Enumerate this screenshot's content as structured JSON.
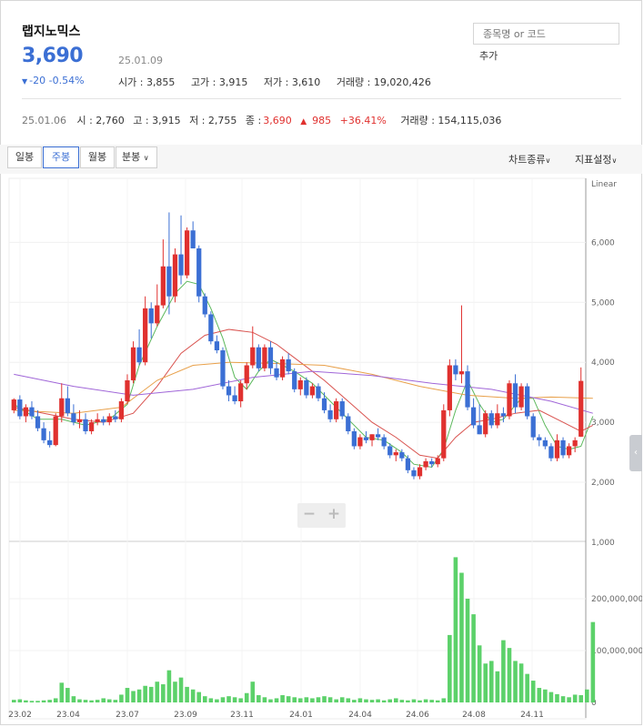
{
  "stock": {
    "name": "랩지노믹스",
    "price": "3,690",
    "date": "25.01.09",
    "change": "-20",
    "change_pct": "-0.54%",
    "open": "시가 : 3,855",
    "high": "고가 : 3,915",
    "low": "저가 : 3,610",
    "volume": "거래량 : 19,020,426"
  },
  "search": {
    "placeholder": "종목명 or 코드",
    "add_label": "추가"
  },
  "period_bar": {
    "date": "25.01.06",
    "open": "시 : 2,760",
    "high": "고 : 3,915",
    "low": "저 : 2,755",
    "close_label": "종 :",
    "close_value": "3,690",
    "diff": "985",
    "diff_pct": "+36.41%",
    "volume": "거래량 : 154,115,036"
  },
  "tabs": {
    "day": "일봉",
    "week": "주봉",
    "month": "월봉",
    "minute": "분봉"
  },
  "controls": {
    "chart_type": "차트종류",
    "indicator": "지표설정"
  },
  "colors": {
    "up": "#e0312f",
    "down": "#3b6fd4",
    "ma5": "#5cb85c",
    "ma20": "#d9534f",
    "ma60": "#e8a04a",
    "ma120": "#a066d8",
    "volume": "#5cd16a"
  },
  "chart_data": {
    "type": "candlestick",
    "scale_label": "Linear",
    "price_ticks": [
      "1,000",
      "2,000",
      "3,000",
      "4,000",
      "5,000",
      "6,000"
    ],
    "volume_ticks": [
      "0",
      "100,000,000",
      "200,000,000"
    ],
    "x_ticks": [
      "23.02",
      "23.04",
      "23.07",
      "23.09",
      "23.11",
      "24.01",
      "24.04",
      "24.06",
      "24.08",
      "24.11"
    ],
    "ohlc": [
      [
        3200,
        3400,
        3150,
        3380
      ],
      [
        3380,
        3450,
        3050,
        3100
      ],
      [
        3100,
        3300,
        3000,
        3250
      ],
      [
        3250,
        3350,
        3050,
        3100
      ],
      [
        3100,
        3200,
        2850,
        2900
      ],
      [
        2900,
        3000,
        2650,
        2700
      ],
      [
        2700,
        2850,
        2580,
        2620
      ],
      [
        2620,
        3150,
        2600,
        3100
      ],
      [
        3100,
        3650,
        3000,
        3400
      ],
      [
        3400,
        3600,
        3100,
        3150
      ],
      [
        3150,
        3300,
        2950,
        3000
      ],
      [
        3000,
        3200,
        2900,
        3050
      ],
      [
        3050,
        3150,
        2800,
        2850
      ],
      [
        2850,
        3050,
        2800,
        3000
      ],
      [
        3000,
        3150,
        2950,
        3050
      ],
      [
        3050,
        3100,
        2950,
        3000
      ],
      [
        3000,
        3150,
        2950,
        3100
      ],
      [
        3100,
        3200,
        3000,
        3050
      ],
      [
        3050,
        3400,
        3000,
        3350
      ],
      [
        3350,
        3800,
        3300,
        3700
      ],
      [
        3700,
        4350,
        3650,
        4250
      ],
      [
        4250,
        4550,
        3950,
        4000
      ],
      [
        4000,
        5100,
        3950,
        4900
      ],
      [
        4900,
        5000,
        4400,
        4650
      ],
      [
        4650,
        5300,
        4600,
        4950
      ],
      [
        4950,
        6050,
        4900,
        5600
      ],
      [
        5600,
        6500,
        4800,
        5100
      ],
      [
        5100,
        5900,
        5000,
        5800
      ],
      [
        5800,
        6450,
        5300,
        5450
      ],
      [
        5450,
        6250,
        5400,
        6200
      ],
      [
        6200,
        6350,
        5900,
        5900
      ],
      [
        5900,
        5950,
        5000,
        5100
      ],
      [
        5100,
        5150,
        4750,
        4800
      ],
      [
        4800,
        4850,
        4300,
        4350
      ],
      [
        4350,
        4450,
        4150,
        4200
      ],
      [
        4200,
        4250,
        3550,
        3600
      ],
      [
        3600,
        3700,
        3350,
        3450
      ],
      [
        3450,
        3600,
        3300,
        3350
      ],
      [
        3350,
        3700,
        3250,
        3650
      ],
      [
        3650,
        4000,
        3550,
        3950
      ],
      [
        3950,
        4600,
        3900,
        4250
      ],
      [
        4250,
        4300,
        3850,
        3900
      ],
      [
        3900,
        4300,
        3850,
        4250
      ],
      [
        4250,
        4350,
        3800,
        3900
      ],
      [
        3900,
        4000,
        3700,
        3750
      ],
      [
        3750,
        4100,
        3700,
        4050
      ],
      [
        4050,
        4150,
        3800,
        3850
      ],
      [
        3850,
        3900,
        3500,
        3550
      ],
      [
        3550,
        3750,
        3450,
        3700
      ],
      [
        3700,
        3750,
        3400,
        3450
      ],
      [
        3450,
        3650,
        3400,
        3600
      ],
      [
        3600,
        3650,
        3350,
        3400
      ],
      [
        3400,
        3500,
        3150,
        3200
      ],
      [
        3200,
        3300,
        3000,
        3050
      ],
      [
        3050,
        3400,
        3000,
        3350
      ],
      [
        3350,
        3400,
        3050,
        3100
      ],
      [
        3100,
        3150,
        2800,
        2850
      ],
      [
        2850,
        2900,
        2550,
        2600
      ],
      [
        2600,
        2800,
        2550,
        2750
      ],
      [
        2750,
        2850,
        2650,
        2700
      ],
      [
        2700,
        2800,
        2600,
        2800
      ],
      [
        2800,
        2900,
        2700,
        2750
      ],
      [
        2750,
        2800,
        2550,
        2600
      ],
      [
        2600,
        2650,
        2400,
        2450
      ],
      [
        2450,
        2550,
        2350,
        2500
      ],
      [
        2500,
        2550,
        2350,
        2400
      ],
      [
        2400,
        2450,
        2150,
        2200
      ],
      [
        2200,
        2250,
        2050,
        2100
      ],
      [
        2100,
        2300,
        2050,
        2250
      ],
      [
        2250,
        2400,
        2200,
        2350
      ],
      [
        2350,
        2400,
        2250,
        2300
      ],
      [
        2300,
        2450,
        2250,
        2400
      ],
      [
        2400,
        3300,
        2350,
        3200
      ],
      [
        3200,
        4050,
        3100,
        3950
      ],
      [
        3950,
        4050,
        3700,
        3800
      ],
      [
        3800,
        4950,
        3650,
        3850
      ],
      [
        3850,
        3950,
        3200,
        3250
      ],
      [
        3250,
        3400,
        2900,
        2950
      ],
      [
        2950,
        3300,
        2800,
        2800
      ],
      [
        2800,
        3200,
        2750,
        3150
      ],
      [
        3150,
        3200,
        2900,
        2950
      ],
      [
        2950,
        3300,
        2900,
        3150
      ],
      [
        3150,
        3250,
        3000,
        3100
      ],
      [
        3100,
        3700,
        3050,
        3650
      ],
      [
        3650,
        3800,
        3150,
        3250
      ],
      [
        3250,
        3650,
        3200,
        3600
      ],
      [
        3600,
        3650,
        3050,
        3100
      ],
      [
        3100,
        3150,
        2700,
        2750
      ],
      [
        2750,
        2800,
        2600,
        2700
      ],
      [
        2700,
        2750,
        2550,
        2600
      ],
      [
        2600,
        2650,
        2350,
        2400
      ],
      [
        2400,
        2800,
        2350,
        2700
      ],
      [
        2700,
        2750,
        2400,
        2450
      ],
      [
        2450,
        2650,
        2400,
        2600
      ],
      [
        2600,
        2750,
        2500,
        2700
      ],
      [
        2760,
        3915,
        2755,
        3690
      ]
    ],
    "ma": [
      {
        "key": "ma5",
        "points": [
          [
            0,
            3300
          ],
          [
            4,
            3050
          ],
          [
            8,
            3050
          ],
          [
            12,
            2950
          ],
          [
            16,
            3050
          ],
          [
            19,
            3300
          ],
          [
            21,
            3950
          ],
          [
            24,
            4600
          ],
          [
            27,
            5150
          ],
          [
            29,
            5350
          ],
          [
            31,
            5300
          ],
          [
            33,
            4900
          ],
          [
            35,
            4400
          ],
          [
            37,
            3750
          ],
          [
            39,
            3550
          ],
          [
            41,
            3850
          ],
          [
            43,
            4050
          ],
          [
            45,
            3950
          ],
          [
            47,
            3850
          ],
          [
            50,
            3650
          ],
          [
            53,
            3350
          ],
          [
            56,
            3050
          ],
          [
            59,
            2750
          ],
          [
            62,
            2700
          ],
          [
            65,
            2500
          ],
          [
            67,
            2300
          ],
          [
            70,
            2250
          ],
          [
            72,
            2550
          ],
          [
            74,
            3200
          ],
          [
            76,
            3700
          ],
          [
            78,
            3300
          ],
          [
            80,
            3000
          ],
          [
            82,
            3050
          ],
          [
            85,
            3400
          ],
          [
            87,
            3400
          ],
          [
            89,
            2950
          ],
          [
            91,
            2600
          ],
          [
            93,
            2550
          ],
          [
            95,
            2600
          ],
          [
            97,
            3100
          ]
        ]
      },
      {
        "key": "ma20",
        "points": [
          [
            0,
            3250
          ],
          [
            5,
            3150
          ],
          [
            10,
            3050
          ],
          [
            15,
            3000
          ],
          [
            20,
            3150
          ],
          [
            24,
            3600
          ],
          [
            28,
            4150
          ],
          [
            32,
            4450
          ],
          [
            36,
            4550
          ],
          [
            40,
            4500
          ],
          [
            44,
            4300
          ],
          [
            48,
            4000
          ],
          [
            52,
            3700
          ],
          [
            56,
            3350
          ],
          [
            60,
            3000
          ],
          [
            64,
            2750
          ],
          [
            68,
            2450
          ],
          [
            71,
            2400
          ],
          [
            74,
            2750
          ],
          [
            77,
            3000
          ],
          [
            80,
            3050
          ],
          [
            84,
            3150
          ],
          [
            88,
            3200
          ],
          [
            92,
            3000
          ],
          [
            95,
            2850
          ],
          [
            97,
            2950
          ]
        ]
      },
      {
        "key": "ma60",
        "points": [
          [
            0,
            3200
          ],
          [
            10,
            3150
          ],
          [
            18,
            3250
          ],
          [
            24,
            3700
          ],
          [
            30,
            3950
          ],
          [
            36,
            4000
          ],
          [
            44,
            3980
          ],
          [
            52,
            3950
          ],
          [
            60,
            3800
          ],
          [
            68,
            3600
          ],
          [
            76,
            3450
          ],
          [
            84,
            3400
          ],
          [
            90,
            3420
          ],
          [
            97,
            3400
          ]
        ]
      },
      {
        "key": "ma120",
        "points": [
          [
            0,
            3800
          ],
          [
            10,
            3600
          ],
          [
            20,
            3450
          ],
          [
            30,
            3550
          ],
          [
            40,
            3750
          ],
          [
            50,
            3850
          ],
          [
            60,
            3780
          ],
          [
            70,
            3650
          ],
          [
            80,
            3550
          ],
          [
            90,
            3350
          ],
          [
            97,
            3150
          ]
        ]
      }
    ],
    "volume": [
      5,
      6,
      4,
      3,
      3,
      4,
      5,
      8,
      38,
      28,
      12,
      6,
      5,
      4,
      5,
      8,
      6,
      5,
      15,
      28,
      22,
      25,
      32,
      30,
      40,
      35,
      62,
      40,
      48,
      30,
      25,
      20,
      12,
      8,
      6,
      10,
      12,
      10,
      8,
      18,
      40,
      14,
      10,
      6,
      8,
      14,
      12,
      10,
      8,
      10,
      8,
      10,
      12,
      10,
      6,
      10,
      8,
      5,
      8,
      6,
      5,
      6,
      4,
      6,
      8,
      5,
      4,
      6,
      4,
      6,
      5,
      4,
      8,
      130,
      280,
      250,
      200,
      170,
      110,
      75,
      80,
      60,
      120,
      105,
      80,
      75,
      55,
      42,
      28,
      25,
      20,
      16,
      12,
      10,
      15,
      14,
      25,
      155
    ]
  }
}
